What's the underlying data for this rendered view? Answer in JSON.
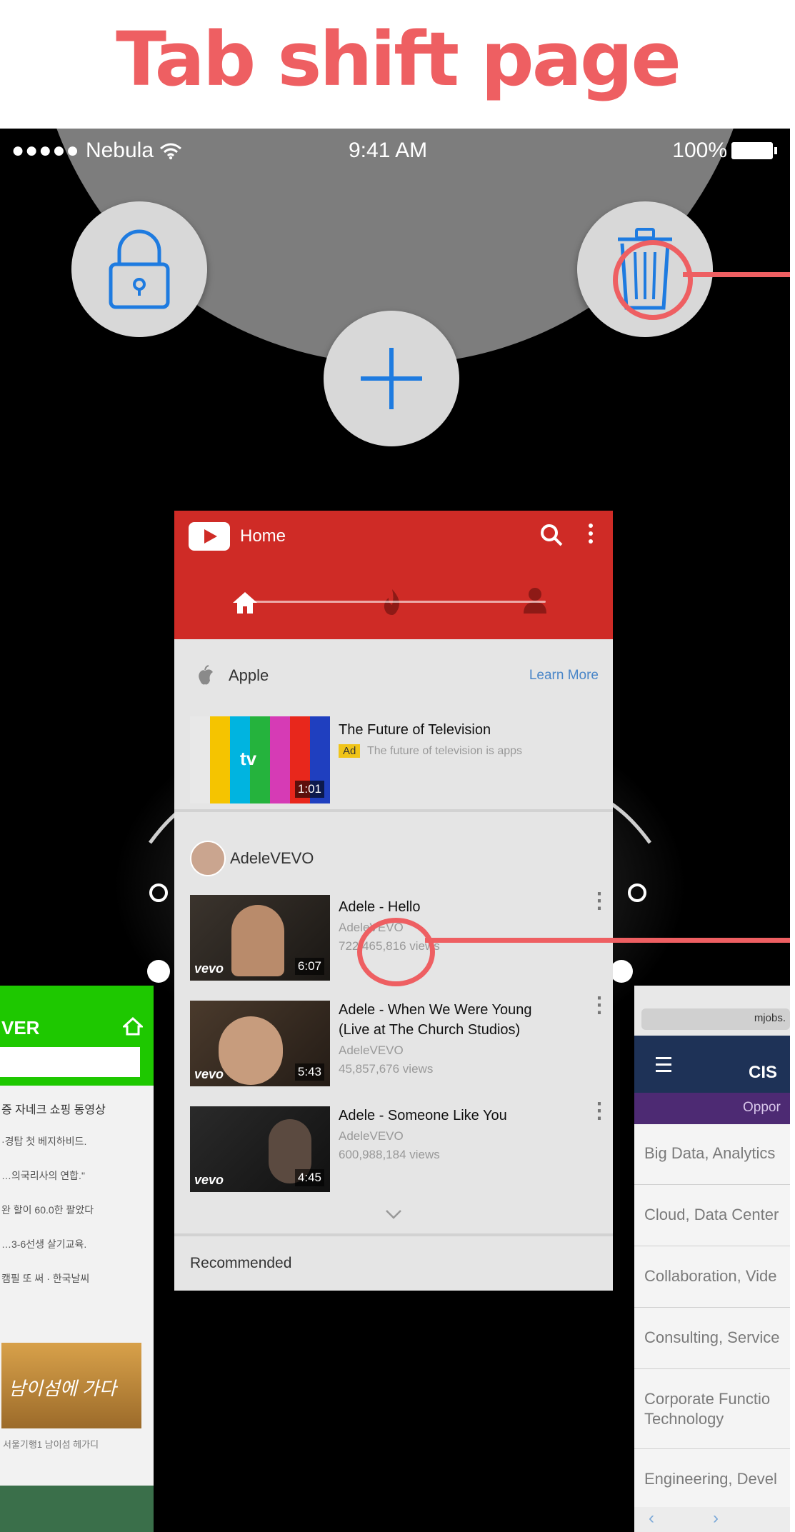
{
  "heading": "Tab shift page",
  "status_bar": {
    "carrier": "Nebula",
    "time": "9:41 AM",
    "battery": "100%"
  },
  "actions": {
    "lock_icon": "lock-icon",
    "add_icon": "plus-icon",
    "trash_icon": "trash-icon"
  },
  "colors": {
    "annotation": "#ee5f62",
    "youtube_red": "#cf2b26",
    "naver_green": "#1ec800",
    "action_blue": "#1e7be0"
  },
  "youtube_tab": {
    "header_title": "Home",
    "promo": {
      "channel": "Apple",
      "link": "Learn More",
      "video_title": "The Future of Television",
      "badge": "Ad",
      "description": "The future of television is apps",
      "duration": "1:01"
    },
    "channel": "AdeleVEVO",
    "videos": [
      {
        "title": "Adele - Hello",
        "channel": "AdeleVEVO",
        "views": "722,465,816 views",
        "duration": "6:07"
      },
      {
        "title": "Adele - When We Were Young",
        "subtitle": "(Live at The Church Studios)",
        "channel": "AdeleVEVO",
        "views": "45,857,676 views",
        "duration": "5:43"
      },
      {
        "title": "Adele - Someone Like You",
        "channel": "AdeleVEVO",
        "views": "600,988,184 views",
        "duration": "4:45"
      }
    ],
    "recommended": "Recommended"
  },
  "naver_tab": {
    "logo": "VER",
    "tabs": "증 자네크 쇼핑 동영상",
    "news": [
      "·경탑 첫 베지하비드.",
      "…의국리사의 연합.\"",
      "완 할이 60.0한 팔았다",
      "…3-6선생 살기교육.",
      "캠필 또 써 · 한국날씨"
    ],
    "banner_caption": "남이섬에 가다",
    "footer": "서울기행1 남이섬 헤가디"
  },
  "cisco_tab": {
    "url": "mjobs.",
    "logo": "CIS",
    "banner": "Oppor",
    "items": [
      "Big Data, Analytics",
      "Cloud, Data Center",
      "Collaboration, Vide",
      "Consulting, Service",
      "Corporate Functio",
      "Technology",
      "Engineering, Devel"
    ]
  }
}
